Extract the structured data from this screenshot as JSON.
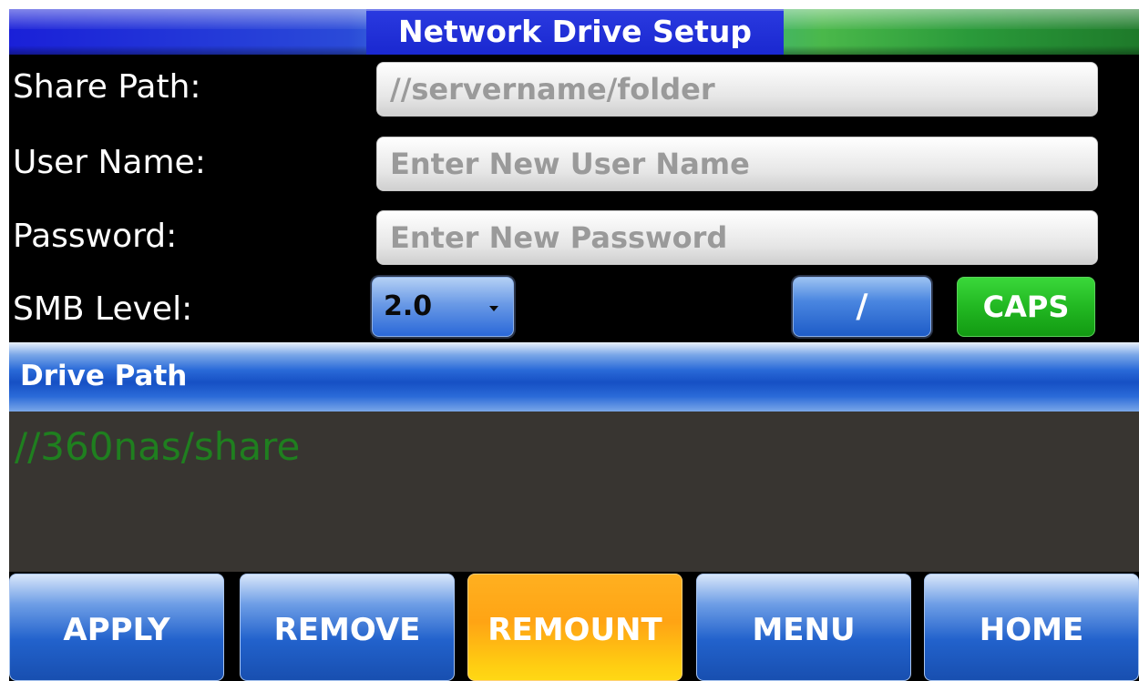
{
  "header": {
    "title": "Network Drive Setup"
  },
  "form": {
    "share_path": {
      "label": "Share Path:",
      "placeholder": "//servername/folder"
    },
    "user_name": {
      "label": "User Name:",
      "placeholder": "Enter New User Name"
    },
    "password": {
      "label": "Password:",
      "placeholder": "Enter New Password"
    },
    "smb_level": {
      "label": "SMB Level:",
      "selected": "2.0"
    }
  },
  "keys": {
    "slash_label": "/",
    "caps_label": "CAPS"
  },
  "drive_path": {
    "header_label": "Drive Path",
    "value": "//360nas/share"
  },
  "bottom_bar": {
    "buttons": [
      {
        "label": "APPLY"
      },
      {
        "label": "REMOVE"
      },
      {
        "label": "REMOUNT"
      },
      {
        "label": "MENU"
      },
      {
        "label": "HOME"
      }
    ]
  },
  "colors": {
    "title_blue": "#1a28d0",
    "button_blue": "#2262cc",
    "caps_green": "#22b822",
    "remount_orange": "#ffa414",
    "drive_path_text": "#1f7f1f",
    "drive_area_bg": "#383531"
  }
}
